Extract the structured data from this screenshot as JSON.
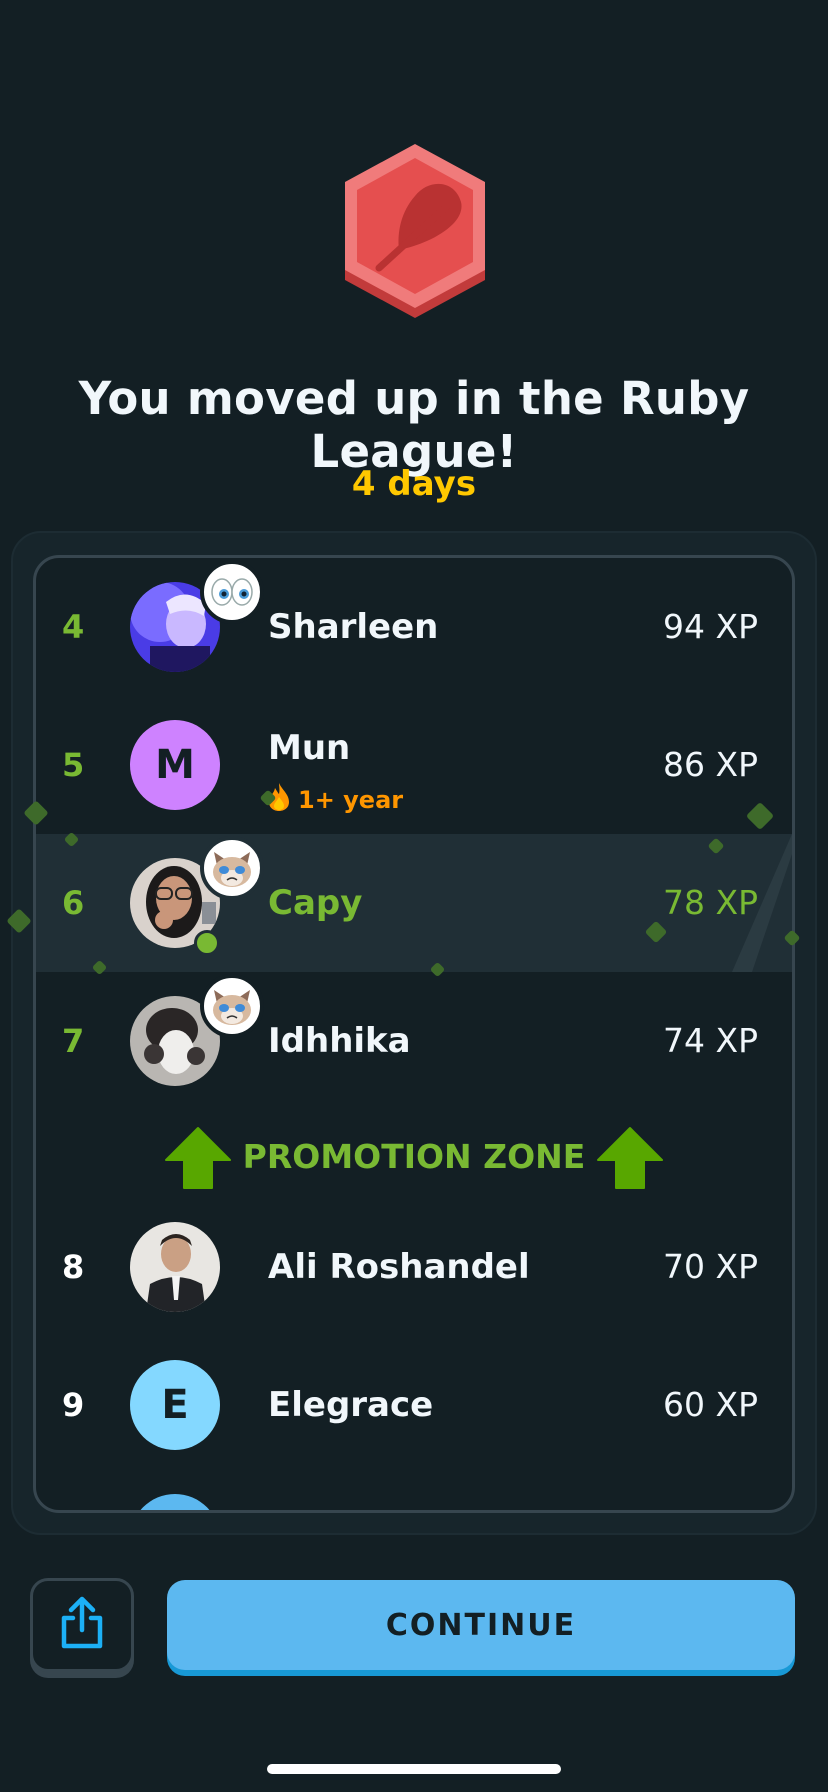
{
  "header": {
    "title": "You moved up in the Ruby League!",
    "days_left": "4 days"
  },
  "leaderboard": {
    "rows": [
      {
        "rank": "4",
        "name": "Sharleen",
        "xp": "94 XP",
        "avatar_type": "photo",
        "sticker": "eyes-icon"
      },
      {
        "rank": "5",
        "name": "Mun",
        "xp": "86 XP",
        "avatar_type": "letter",
        "avatar_letter": "M",
        "avatar_color": "#ce82ff",
        "streak": "1+ year"
      },
      {
        "rank": "6",
        "name": "Capy",
        "xp": "78 XP",
        "avatar_type": "photo",
        "sticker": "cat-icon",
        "current_user": true,
        "online": true
      },
      {
        "rank": "7",
        "name": "Idhhika",
        "xp": "74 XP",
        "avatar_type": "photo",
        "sticker": "cat-icon"
      },
      {
        "rank": "8",
        "name": "Ali Roshandel",
        "xp": "70 XP",
        "avatar_type": "photo"
      },
      {
        "rank": "9",
        "name": "Elegrace",
        "xp": "60 XP",
        "avatar_type": "letter",
        "avatar_letter": "E",
        "avatar_color": "#84d8ff"
      }
    ],
    "promotion_zone_label": "PROMOTION ZONE"
  },
  "footer": {
    "share_icon": "share-icon",
    "continue_label": "CONTINUE"
  },
  "colors": {
    "background": "#131f24",
    "accent_green": "#79b933",
    "accent_gold": "#ffc800",
    "button_blue": "#5cb8f0",
    "ruby": "#ee5555"
  }
}
